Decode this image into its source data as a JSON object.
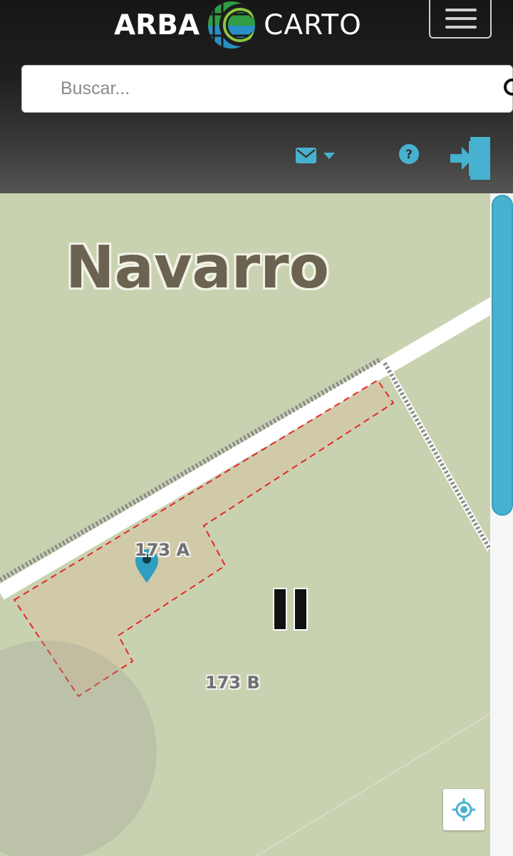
{
  "header": {
    "logo": {
      "left_text": "ARBA",
      "right_text": "CARTO",
      "icon": "arba-globe-logo-icon"
    },
    "menu_icon": "hamburger-menu-icon",
    "search": {
      "placeholder": "Buscar...",
      "value": "",
      "icon": "search-icon"
    },
    "toolbar": {
      "mail_icon": "envelope-dropdown-icon",
      "help_icon": "question-circle-icon",
      "login_icon": "sign-in-door-icon"
    }
  },
  "map": {
    "place_label": "Navarro",
    "parcels": [
      {
        "label": "173 A"
      },
      {
        "label": "173 B"
      }
    ],
    "marker_icon": "map-pin-icon",
    "pause_icon": "pause-icon",
    "locate_icon": "crosshair-locate-icon"
  },
  "colors": {
    "accent": "#46b2cf",
    "map_background": "#c8d2b0",
    "parcel_border": "#e02a2a",
    "header_dark": "#161616"
  }
}
